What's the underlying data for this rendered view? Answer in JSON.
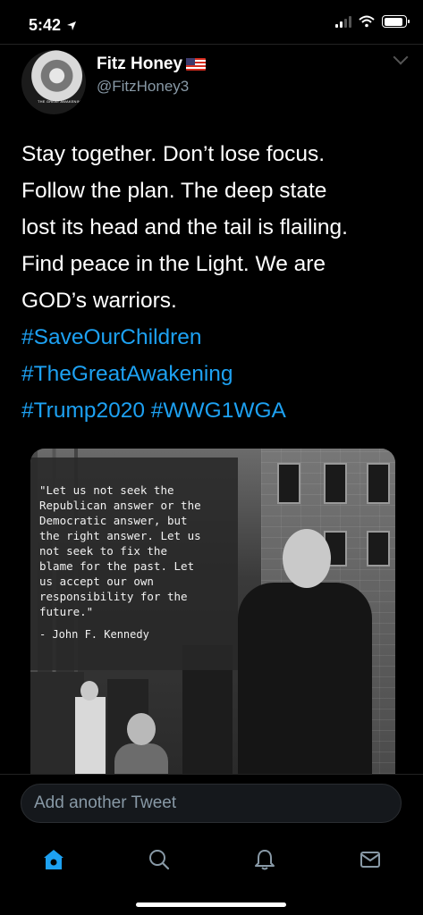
{
  "status_bar": {
    "time": "5:42",
    "battery_percent": 90
  },
  "tweet": {
    "author": {
      "display_name": "Fitz Honey",
      "handle": "@FitzHoney3",
      "avatar_caption": "THE GREAT AWAKENING"
    },
    "lines": [
      {
        "text": "Stay together. Don’t lose focus.",
        "type": "text"
      },
      {
        "text": "Follow the plan. The deep state",
        "type": "text"
      },
      {
        "text": "lost its head and the tail is flailing.",
        "type": "text"
      },
      {
        "text": "Find peace in the Light. We are",
        "type": "text"
      },
      {
        "text": "GOD’s warriors.",
        "type": "text"
      },
      {
        "text": "#SaveOurChildren",
        "type": "hashtag"
      },
      {
        "text": "#TheGreatAwakening",
        "type": "hashtag"
      },
      {
        "text": "#Trump2020 #WWG1WGA",
        "type": "hashtag"
      }
    ],
    "media": {
      "quote": "\"Let us not seek the\nRepublican answer or the\nDemocratic answer, but\nthe right answer. Let us\nnot seek to fix the\nblame for the past. Let\nus accept our own\nresponsibility for the\nfuture.\"",
      "quote_author": "- John F. Kennedy"
    }
  },
  "composer": {
    "placeholder": "Add another Tweet"
  },
  "tab_bar": {
    "active": "home",
    "active_color": "#1da1f2",
    "icon_color": "#8899a6"
  }
}
